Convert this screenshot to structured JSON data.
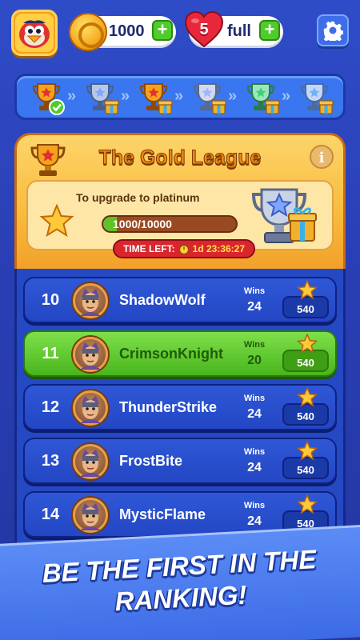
{
  "topbar": {
    "coins": "1000",
    "lives_count": "5",
    "lives_status": "full",
    "plus": "+"
  },
  "track": {
    "stages": [
      {
        "icon": "trophy-bronze-icon",
        "completed": true
      },
      {
        "icon": "trophy-silver-gift-icon",
        "completed": false
      },
      {
        "icon": "trophy-gold-gift-icon",
        "completed": false
      },
      {
        "icon": "trophy-platinum-gift-icon",
        "completed": false
      },
      {
        "icon": "trophy-emerald-gift-icon",
        "completed": false
      },
      {
        "icon": "trophy-diamond-gift-icon",
        "completed": false
      }
    ],
    "separator": "»"
  },
  "league": {
    "title": "The Gold League",
    "info": "i",
    "upgrade_text": "To upgrade to platinum",
    "progress_text": "1000/10000",
    "progress_fraction": 0.1,
    "time_left_label": "TIME LEFT:",
    "time_left_value": "1d 23:36:27"
  },
  "ranking": {
    "wins_label": "Wins",
    "rows": [
      {
        "rank": "10",
        "name": "ShadowWolf",
        "wins": "24",
        "score": "540",
        "highlight": false
      },
      {
        "rank": "11",
        "name": "CrimsonKnight",
        "wins": "20",
        "score": "540",
        "highlight": true
      },
      {
        "rank": "12",
        "name": "ThunderStrike",
        "wins": "24",
        "score": "540",
        "highlight": false
      },
      {
        "rank": "13",
        "name": "FrostBite",
        "wins": "24",
        "score": "540",
        "highlight": false
      },
      {
        "rank": "14",
        "name": "MysticFlame",
        "wins": "24",
        "score": "540",
        "highlight": false
      }
    ]
  },
  "banner": {
    "line1": "BE THE FIRST IN THE",
    "line2": "RANKING!"
  },
  "colors": {
    "background": "#2f4cc8",
    "gold": "#f9bb3b",
    "highlight_green": "#49b51d",
    "timer_red": "#d9262d"
  }
}
